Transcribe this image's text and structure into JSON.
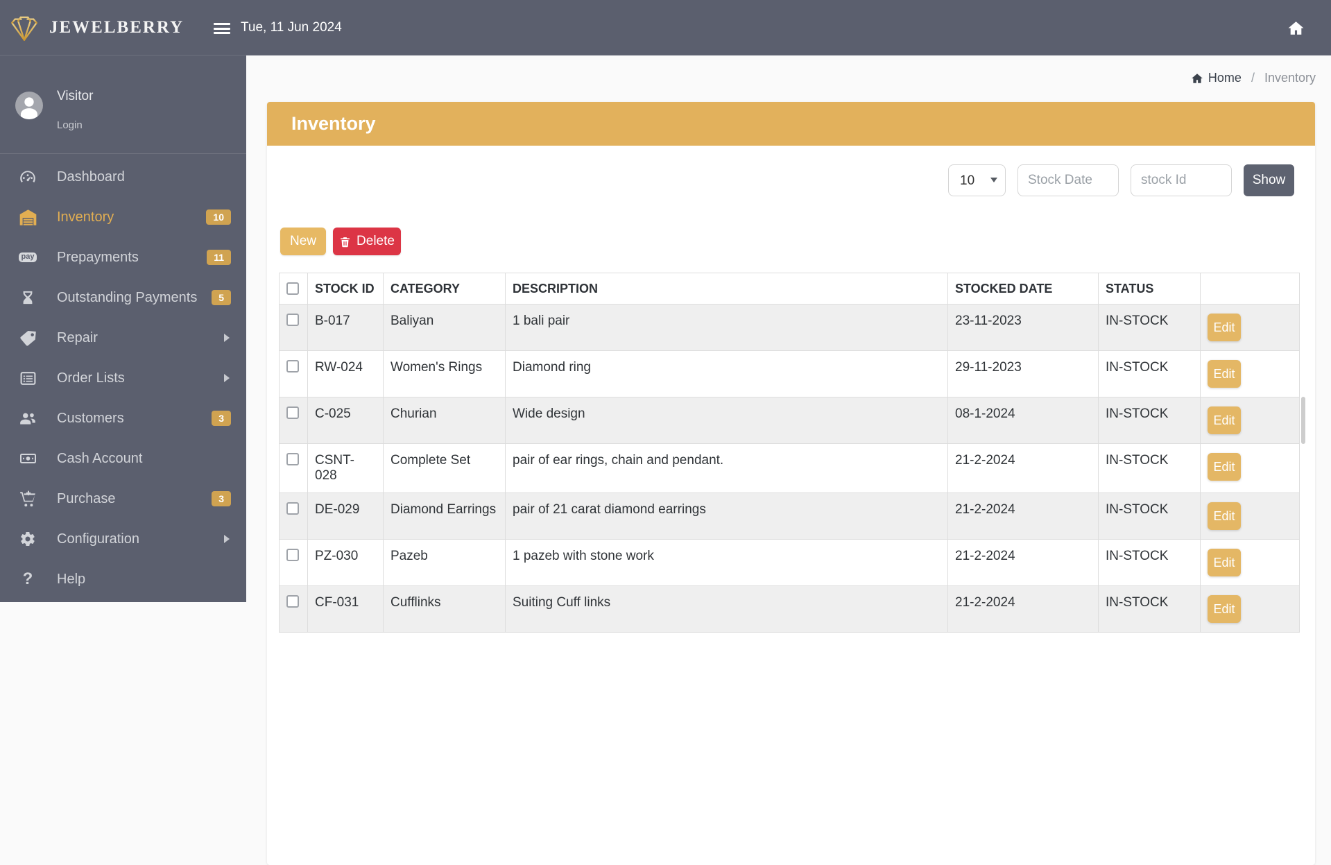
{
  "header": {
    "brand": "JEWELBERRY",
    "date": "Tue, 11 Jun 2024"
  },
  "user": {
    "name": "Visitor",
    "login_label": "Login"
  },
  "sidebar": {
    "items": [
      {
        "label": "Dashboard",
        "icon": "dashboard-icon",
        "badge": "",
        "active": false
      },
      {
        "label": "Inventory",
        "icon": "warehouse-icon",
        "badge": "10",
        "active": true
      },
      {
        "label": "Prepayments",
        "icon": "pay-icon",
        "badge": "11",
        "active": false
      },
      {
        "label": "Outstanding Payments",
        "icon": "hourglass-icon",
        "badge": "5",
        "active": false
      },
      {
        "label": "Repair",
        "icon": "tag-icon",
        "badge": "",
        "active": false,
        "arrow": true
      },
      {
        "label": "Order Lists",
        "icon": "list-icon",
        "badge": "",
        "active": false,
        "arrow": true
      },
      {
        "label": "Customers",
        "icon": "users-icon",
        "badge": "3",
        "active": false
      },
      {
        "label": "Cash Account",
        "icon": "money-icon",
        "badge": "",
        "active": false
      },
      {
        "label": "Purchase",
        "icon": "cart-plus-icon",
        "badge": "3",
        "active": false
      },
      {
        "label": "Configuration",
        "icon": "gear-icon",
        "badge": "",
        "active": false,
        "arrow": true
      },
      {
        "label": "Help",
        "icon": "question-icon",
        "badge": "",
        "active": false
      }
    ]
  },
  "breadcrumb": {
    "home": "Home",
    "separator": "/",
    "current": "Inventory"
  },
  "page": {
    "title": "Inventory"
  },
  "filters": {
    "page_size": "10",
    "stock_date_placeholder": "Stock Date",
    "stock_id_placeholder": "stock Id",
    "show_label": "Show"
  },
  "actions": {
    "new_label": "New",
    "delete_label": "Delete"
  },
  "table": {
    "columns": {
      "stock_id": "STOCK ID",
      "category": "CATEGORY",
      "description": "DESCRIPTION",
      "stocked_date": "STOCKED DATE",
      "status": "STATUS"
    },
    "edit_label": "Edit",
    "rows": [
      {
        "stock_id": "B-017",
        "category": "Baliyan",
        "description": "1 bali pair",
        "stocked_date": "23-11-2023",
        "status": "IN-STOCK"
      },
      {
        "stock_id": "RW-024",
        "category": "Women's Rings",
        "description": "Diamond ring",
        "stocked_date": "29-11-2023",
        "status": "IN-STOCK"
      },
      {
        "stock_id": "C-025",
        "category": "Churian",
        "description": "Wide design",
        "stocked_date": "08-1-2024",
        "status": "IN-STOCK"
      },
      {
        "stock_id": "CSNT-028",
        "category": "Complete Set",
        "description": "pair of ear rings, chain and pendant.",
        "stocked_date": "21-2-2024",
        "status": "IN-STOCK"
      },
      {
        "stock_id": "DE-029",
        "category": "Diamond Earrings",
        "description": "pair of 21 carat diamond earrings",
        "stocked_date": "21-2-2024",
        "status": "IN-STOCK"
      },
      {
        "stock_id": "PZ-030",
        "category": "Pazeb",
        "description": "1 pazeb with stone work",
        "stocked_date": "21-2-2024",
        "status": "IN-STOCK"
      },
      {
        "stock_id": "CF-031",
        "category": "Cufflinks",
        "description": "Suiting Cuff links",
        "stocked_date": "21-2-2024",
        "status": "IN-STOCK"
      }
    ]
  },
  "colors": {
    "topbar_sidebar": "#5b5f6e",
    "gold_accent": "#e2b15c",
    "badge_gold": "#d0a351",
    "edit_button": "#e4b765",
    "danger_red": "#dc3545",
    "show_button": "#5d6270",
    "stripe_row": "#efefef"
  }
}
